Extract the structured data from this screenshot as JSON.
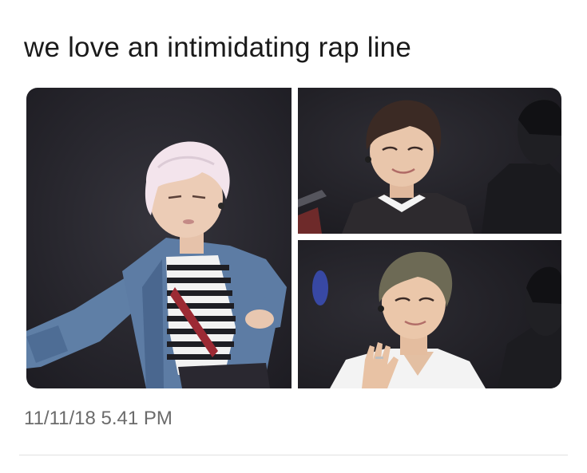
{
  "tweet": {
    "text": "we love an intimidating rap line",
    "timestamp": "11/11/18 5.41 PM"
  },
  "media": {
    "photos": [
      {
        "subject": "performer with platinum hair in denim jacket and striped shirt"
      },
      {
        "subject": "performer with brown hair smiling"
      },
      {
        "subject": "performer with ash hair waving"
      }
    ]
  },
  "colors": {
    "text": "#1a1a1a",
    "timestamp": "#6b6b6b",
    "divider": "#e1e1e1",
    "photo_background": "#24232a"
  }
}
